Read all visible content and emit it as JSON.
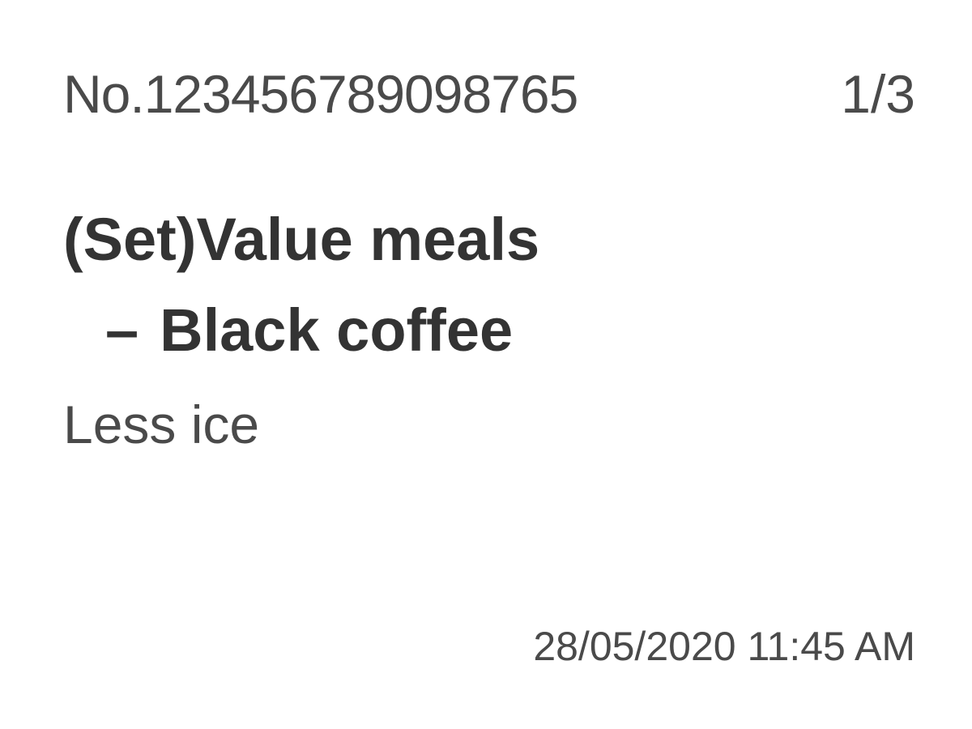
{
  "ticket": {
    "order_number": "No.12345678909876​5",
    "page_indicator": "1/3",
    "item_name": "(Set)Value meals",
    "sub_item": {
      "prefix": "–",
      "name": "Black coffee"
    },
    "note": "Less ice",
    "timestamp": "28/05/2020 11:45 AM"
  },
  "colors": {
    "background": "#ffffff",
    "primary_text": "#333333",
    "secondary_text": "#4a4a4a"
  }
}
